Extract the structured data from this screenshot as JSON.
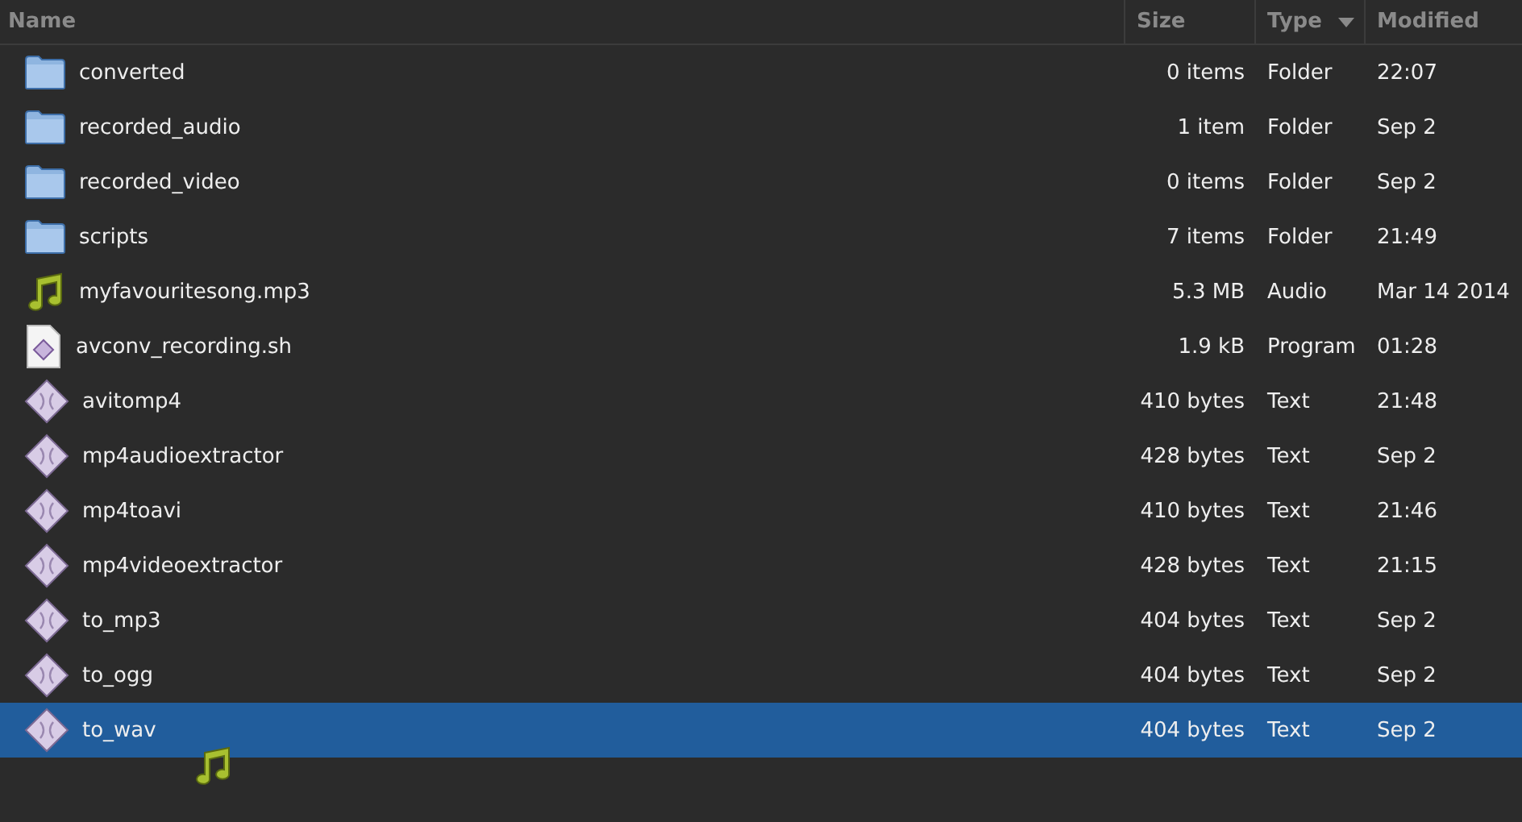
{
  "columns": [
    {
      "label": "Name",
      "sorted": false
    },
    {
      "label": "Size",
      "sorted": false
    },
    {
      "label": "Type",
      "sorted": true
    },
    {
      "label": "Modified",
      "sorted": false
    }
  ],
  "rows": [
    {
      "kind": "folder",
      "name": "converted",
      "size": "0 items",
      "type": "Folder",
      "modified": "22:07",
      "selected": false
    },
    {
      "kind": "folder",
      "name": "recorded_audio",
      "size": "1 item",
      "type": "Folder",
      "modified": "Sep 2",
      "selected": false
    },
    {
      "kind": "folder",
      "name": "recorded_video",
      "size": "0 items",
      "type": "Folder",
      "modified": "Sep 2",
      "selected": false
    },
    {
      "kind": "folder",
      "name": "scripts",
      "size": "7 items",
      "type": "Folder",
      "modified": "21:49",
      "selected": false
    },
    {
      "kind": "audio",
      "name": "myfavouritesong.mp3",
      "size": "5.3 MB",
      "type": "Audio",
      "modified": "Mar 14 2014",
      "selected": false
    },
    {
      "kind": "script",
      "name": "avconv_recording.sh",
      "size": "1.9 kB",
      "type": "Program",
      "modified": "01:28",
      "selected": false
    },
    {
      "kind": "text",
      "name": "avitomp4",
      "size": "410 bytes",
      "type": "Text",
      "modified": "21:48",
      "selected": false
    },
    {
      "kind": "text",
      "name": "mp4audioextractor",
      "size": "428 bytes",
      "type": "Text",
      "modified": "Sep 2",
      "selected": false
    },
    {
      "kind": "text",
      "name": "mp4toavi",
      "size": "410 bytes",
      "type": "Text",
      "modified": "21:46",
      "selected": false
    },
    {
      "kind": "text",
      "name": "mp4videoextractor",
      "size": "428 bytes",
      "type": "Text",
      "modified": "21:15",
      "selected": false
    },
    {
      "kind": "text",
      "name": "to_mp3",
      "size": "404 bytes",
      "type": "Text",
      "modified": "Sep 2",
      "selected": false
    },
    {
      "kind": "text",
      "name": "to_ogg",
      "size": "404 bytes",
      "type": "Text",
      "modified": "Sep 2",
      "selected": false
    },
    {
      "kind": "text",
      "name": "to_wav",
      "size": "404 bytes",
      "type": "Text",
      "modified": "Sep 2",
      "selected": true
    }
  ]
}
